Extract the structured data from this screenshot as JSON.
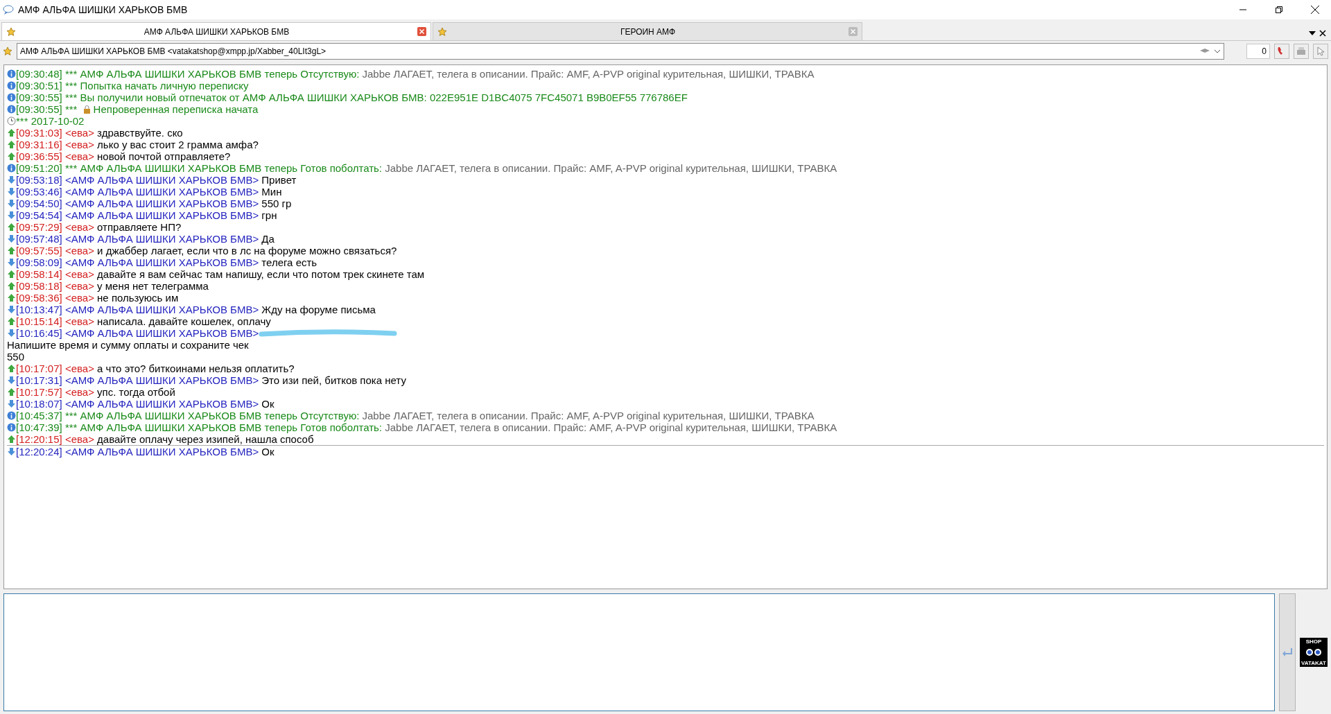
{
  "window": {
    "title": "АМФ АЛЬФА ШИШКИ ХАРЬКОВ БМВ"
  },
  "tabs": [
    {
      "label": "АМФ АЛЬФА ШИШКИ ХАРЬКОВ БМВ",
      "selected": true
    },
    {
      "label": "ГЕРОИН АМФ",
      "selected": false
    }
  ],
  "contact_bar": {
    "address": "АМФ АЛЬФА ШИШКИ ХАРЬКОВ БМВ <vatakatshop@xmpp.jp/Xabber_40LIt3gL>",
    "counter": "0"
  },
  "messages": [
    {
      "kind": "status",
      "time": "[09:30:48]",
      "text": "*** АМФ АЛЬФА ШИШКИ ХАРЬКОВ БМВ теперь Отсутствую:",
      "note": " Jabbe ЛАГАЕТ, телега в описании. Прайс: AMF, A-PVP original курительная, ШИШКИ, ТРАВКА"
    },
    {
      "kind": "status",
      "time": "[09:30:51]",
      "text": "*** Попытка начать личную переписку"
    },
    {
      "kind": "status",
      "time": "[09:30:55]",
      "text": "*** Вы получили новый отпечаток от АМФ АЛЬФА ШИШКИ ХАРЬКОВ БМВ: 022E951E D1BC4075 7FC45071 B9B0EF55 776786EF"
    },
    {
      "kind": "status",
      "time": "[09:30:55]",
      "text": "*** ",
      "lock": true,
      "after_lock": "Непроверенная переписка начата"
    },
    {
      "kind": "date",
      "text": "*** 2017-10-02"
    },
    {
      "kind": "out",
      "time": "[09:31:03]",
      "nick": "<ева>",
      "text": " здравствуйте. ско"
    },
    {
      "kind": "out",
      "time": "[09:31:16]",
      "nick": "<ева>",
      "text": " лько у вас стоит 2 грамма амфа?"
    },
    {
      "kind": "out",
      "time": "[09:36:55]",
      "nick": "<ева>",
      "text": " новой почтой отправляете?"
    },
    {
      "kind": "status",
      "time": "[09:51:20]",
      "text": "*** АМФ АЛЬФА ШИШКИ ХАРЬКОВ БМВ теперь Готов поболтать:",
      "note": " Jabbe ЛАГАЕТ, телега в описании. Прайс: AMF, A-PVP original курительная, ШИШКИ, ТРАВКА"
    },
    {
      "kind": "in",
      "time": "[09:53:18]",
      "nick": "<АМФ АЛЬФА ШИШКИ ХАРЬКОВ БМВ>",
      "text": " Привет"
    },
    {
      "kind": "in",
      "time": "[09:53:46]",
      "nick": "<АМФ АЛЬФА ШИШКИ ХАРЬКОВ БМВ>",
      "text": " Мин"
    },
    {
      "kind": "in",
      "time": "[09:54:50]",
      "nick": "<АМФ АЛЬФА ШИШКИ ХАРЬКОВ БМВ>",
      "text": " 550 гр"
    },
    {
      "kind": "in",
      "time": "[09:54:54]",
      "nick": "<АМФ АЛЬФА ШИШКИ ХАРЬКОВ БМВ>",
      "text": " грн"
    },
    {
      "kind": "out",
      "time": "[09:57:29]",
      "nick": "<ева>",
      "text": " отправляете НП?"
    },
    {
      "kind": "in",
      "time": "[09:57:48]",
      "nick": "<АМФ АЛЬФА ШИШКИ ХАРЬКОВ БМВ>",
      "text": " Да"
    },
    {
      "kind": "out",
      "time": "[09:57:55]",
      "nick": "<ева>",
      "text": " и джаббер лагает, если что в лс на форуме можно связаться?"
    },
    {
      "kind": "in",
      "time": "[09:58:09]",
      "nick": "<АМФ АЛЬФА ШИШКИ ХАРЬКОВ БМВ>",
      "text": " телега есть"
    },
    {
      "kind": "out",
      "time": "[09:58:14]",
      "nick": "<ева>",
      "text": " давайте я вам сейчас там напишу, если что потом трек скинете там"
    },
    {
      "kind": "out",
      "time": "[09:58:18]",
      "nick": "<ева>",
      "text": " у меня нет телеграмма"
    },
    {
      "kind": "out",
      "time": "[09:58:36]",
      "nick": "<ева>",
      "text": " не пользуюсь им"
    },
    {
      "kind": "in",
      "time": "[10:13:47]",
      "nick": "<АМФ АЛЬФА ШИШКИ ХАРЬКОВ БМВ>",
      "text": " Жду на форуме письма"
    },
    {
      "kind": "out",
      "time": "[10:15:14]",
      "nick": "<ева>",
      "text": " написала. давайте кошелек, оплачу"
    },
    {
      "kind": "in",
      "time": "[10:16:45]",
      "nick": "<АМФ АЛЬФА ШИШКИ ХАРЬКОВ БМВ>",
      "redacted": true,
      "lines": [
        "Напишите время и сумму оплаты и сохраните чек",
        "550"
      ]
    },
    {
      "kind": "out",
      "time": "[10:17:07]",
      "nick": "<ева>",
      "text": " а что это? биткоинами нельзя оплатить?"
    },
    {
      "kind": "in",
      "time": "[10:17:31]",
      "nick": "<АМФ АЛЬФА ШИШКИ ХАРЬКОВ БМВ>",
      "text": " Это изи пей, битков пока нету"
    },
    {
      "kind": "out",
      "time": "[10:17:57]",
      "nick": "<ева>",
      "text": " упс. тогда отбой"
    },
    {
      "kind": "in",
      "time": "[10:18:07]",
      "nick": "<АМФ АЛЬФА ШИШКИ ХАРЬКОВ БМВ>",
      "text": " Ок"
    },
    {
      "kind": "status",
      "time": "[10:45:37]",
      "text": "*** АМФ АЛЬФА ШИШКИ ХАРЬКОВ БМВ теперь Отсутствую:",
      "note": " Jabbe ЛАГАЕТ, телега в описании. Прайс: AMF, A-PVP original курительная, ШИШКИ, ТРАВКА"
    },
    {
      "kind": "status",
      "time": "[10:47:39]",
      "text": "*** АМФ АЛЬФА ШИШКИ ХАРЬКОВ БМВ теперь Готов поболтать:",
      "note": " Jabbe ЛАГАЕТ, телега в описании. Прайс: AMF, A-PVP original курительная, ШИШКИ, ТРАВКА"
    },
    {
      "kind": "out",
      "time": "[12:20:15]",
      "nick": "<ева>",
      "text": " давайте оплачу через изипей, нашла способ"
    },
    {
      "kind": "in",
      "time": "[12:20:24]",
      "nick": "<АМФ АЛЬФА ШИШКИ ХАРЬКОВ БМВ>",
      "text": " Ок",
      "unread_marker": true
    }
  ],
  "logo": {
    "top": "SHOP",
    "bottom": "VATAKAT"
  }
}
